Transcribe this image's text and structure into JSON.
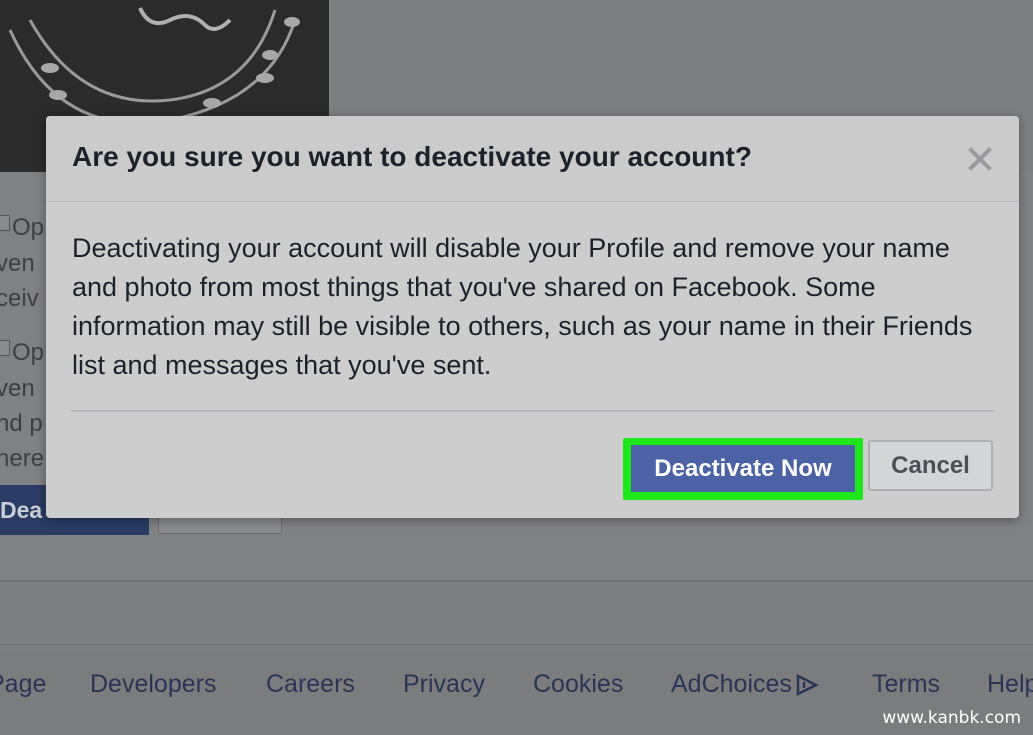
{
  "dialog": {
    "title": "Are you sure you want to deactivate your account?",
    "body": "Deactivating your account will disable your Profile and remove your name and photo from most things that you've shared on Facebook. Some information may still be visible to others, such as your name in their Friends list and messages that you've sent.",
    "deactivate_label": "Deactivate Now",
    "cancel_label": "Cancel",
    "close_icon": "close-icon"
  },
  "background": {
    "option_1_fragment": "Op",
    "option_1_line_2": "ven",
    "option_1_line_3": "ceiv",
    "option_2_fragment": "Op",
    "option_2_line_2": "ven",
    "option_2_line_3": "nd p",
    "option_2_line_4": "here",
    "deactivate_fragment": "Dea"
  },
  "footer": {
    "links": [
      "Page",
      "Developers",
      "Careers",
      "Privacy",
      "Cookies",
      "AdChoices",
      "Terms",
      "Help"
    ]
  },
  "watermark": "www.kanbk.com",
  "colors": {
    "primary_button": "#4d62a4",
    "highlight": "#1ee81a",
    "overlay": "#7d7e80"
  }
}
